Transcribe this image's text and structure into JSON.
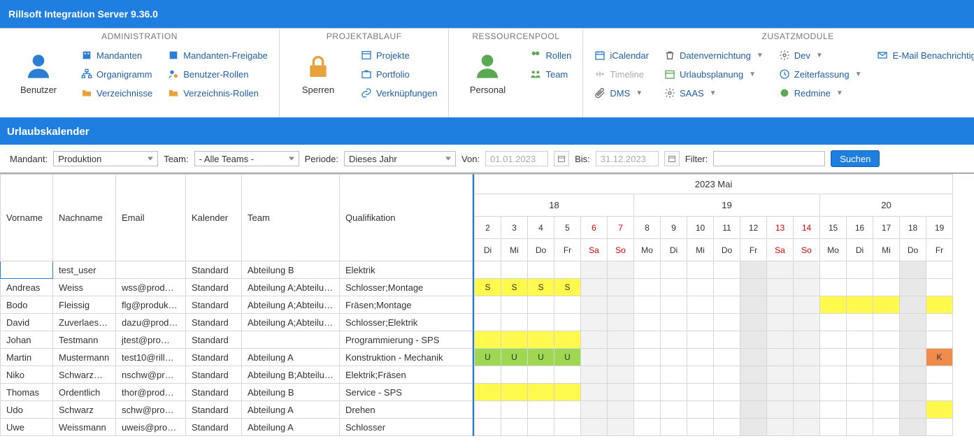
{
  "app": {
    "title": "Rillsoft Integration Server 9.36.0"
  },
  "ribbon": {
    "admin": {
      "title": "ADMINISTRATION",
      "big": "Benutzer",
      "items": [
        "Mandanten",
        "Organigramm",
        "Verzeichnisse",
        "Mandanten-Freigabe",
        "Benutzer-Rollen",
        "Verzeichnis-Rollen"
      ]
    },
    "projekt": {
      "title": "PROJEKTABLAUF",
      "big": "Sperren",
      "items": [
        "Projekte",
        "Portfolio",
        "Verknüpfungen"
      ]
    },
    "ressourcen": {
      "title": "RESSOURCENPOOL",
      "big": "Personal",
      "items": [
        "Rollen",
        "Team"
      ]
    },
    "zusatz": {
      "title": "ZUSATZMODULE",
      "col1": [
        "iCalendar",
        "Timeline",
        "DMS"
      ],
      "col2": [
        "Datenvernichtung",
        "Urlaubsplanung",
        "SAAS"
      ],
      "col3": [
        "Dev",
        "Zeiterfassung",
        "Redmine"
      ],
      "col4": [
        "E-Mail Benachrichtigungen"
      ]
    }
  },
  "sectionTitle": "Urlaubskalender",
  "filter": {
    "mandant_label": "Mandant:",
    "mandant_value": "Produktion",
    "team_label": "Team:",
    "team_value": "- Alle Teams -",
    "periode_label": "Periode:",
    "periode_value": "Dieses Jahr",
    "von_label": "Von:",
    "von_value": "01.01.2023",
    "bis_label": "Bis:",
    "bis_value": "31.12.2023",
    "filter_label": "Filter:",
    "search_button": "Suchen"
  },
  "grid": {
    "headers": {
      "vorname": "Vorname",
      "nachname": "Nachname",
      "email": "Email",
      "kalender": "Kalender",
      "team": "Team",
      "qualifikation": "Qualifikation"
    },
    "month": "2023 Mai",
    "weeks": [
      "18",
      "19",
      "20"
    ],
    "days": [
      "2",
      "3",
      "4",
      "5",
      "6",
      "7",
      "8",
      "9",
      "10",
      "11",
      "12",
      "13",
      "14",
      "15",
      "16",
      "17",
      "18",
      "19"
    ],
    "weekdays": [
      "Di",
      "Mi",
      "Do",
      "Fr",
      "Sa",
      "So",
      "Mo",
      "Di",
      "Mi",
      "Do",
      "Fr",
      "Sa",
      "So",
      "Mo",
      "Di",
      "Mi",
      "Do",
      "Fr"
    ],
    "weekend_positions": [
      4,
      5,
      11,
      12
    ],
    "rows": [
      {
        "vorname": "",
        "nachname": "test_user",
        "email": "",
        "kalender": "Standard",
        "team": "Abteilung B",
        "qual": "Elektrik",
        "cells": {}
      },
      {
        "vorname": "Andreas",
        "nachname": "Weiss",
        "email": "wss@prod…",
        "kalender": "Standard",
        "team": "Abteilung A;Abteilu…",
        "qual": "Schlosser;Montage",
        "cells": {
          "0": {
            "t": "S",
            "c": "yellow"
          },
          "1": {
            "t": "S",
            "c": "yellow"
          },
          "2": {
            "t": "S",
            "c": "yellow"
          },
          "3": {
            "t": "S",
            "c": "yellow"
          }
        }
      },
      {
        "vorname": "Bodo",
        "nachname": "Fleissig",
        "email": "flg@produk…",
        "kalender": "Standard",
        "team": "Abteilung A;Abteilu…",
        "qual": "Fräsen;Montage",
        "cells": {
          "13": {
            "t": "",
            "c": "yellow"
          },
          "14": {
            "t": "",
            "c": "yellow"
          },
          "15": {
            "t": "",
            "c": "yellow"
          },
          "17": {
            "t": "",
            "c": "yellow"
          }
        }
      },
      {
        "vorname": "David",
        "nachname": "Zuverlaessig",
        "email": "dazu@prod…",
        "kalender": "Standard",
        "team": "Abteilung A;Abteilu…",
        "qual": "Schlosser;Elektrik",
        "cells": {}
      },
      {
        "vorname": "Johan",
        "nachname": "Testmann",
        "email": "jtest@pro…",
        "kalender": "Standard",
        "team": "",
        "qual": "Programmierung - SPS",
        "cells": {
          "0": {
            "t": "",
            "c": "yellow"
          },
          "1": {
            "t": "",
            "c": "yellow"
          },
          "2": {
            "t": "",
            "c": "yellow"
          },
          "3": {
            "t": "",
            "c": "yellow"
          }
        }
      },
      {
        "vorname": "Martin",
        "nachname": "Mustermann",
        "email": "test10@rill…",
        "kalender": "Standard",
        "team": "Abteilung A",
        "qual": "Konstruktion - Mechanik",
        "cells": {
          "0": {
            "t": "U",
            "c": "green"
          },
          "1": {
            "t": "U",
            "c": "green"
          },
          "2": {
            "t": "U",
            "c": "green"
          },
          "3": {
            "t": "U",
            "c": "green"
          },
          "17": {
            "t": "K",
            "c": "orange"
          }
        }
      },
      {
        "vorname": "Niko",
        "nachname": "Schwarzm…",
        "email": "nschw@pr…",
        "kalender": "Standard",
        "team": "Abteilung B;Abteilu…",
        "qual": "Elektrik;Fräsen",
        "cells": {}
      },
      {
        "vorname": "Thomas",
        "nachname": "Ordentlich",
        "email": "thor@prod…",
        "kalender": "Standard",
        "team": "Abteilung B",
        "qual": "Service - SPS",
        "cells": {
          "0": {
            "t": "",
            "c": "yellow"
          },
          "1": {
            "t": "",
            "c": "yellow"
          },
          "2": {
            "t": "",
            "c": "yellow"
          },
          "3": {
            "t": "",
            "c": "yellow"
          }
        }
      },
      {
        "vorname": "Udo",
        "nachname": "Schwarz",
        "email": "schw@pro…",
        "kalender": "Standard",
        "team": "Abteilung A",
        "qual": "Drehen",
        "cells": {
          "17": {
            "t": "",
            "c": "yellow"
          }
        }
      },
      {
        "vorname": "Uwe",
        "nachname": "Weissmann",
        "email": "uweis@pro…",
        "kalender": "Standard",
        "team": "Abteilung A",
        "qual": "Schlosser",
        "cells": {}
      }
    ]
  }
}
